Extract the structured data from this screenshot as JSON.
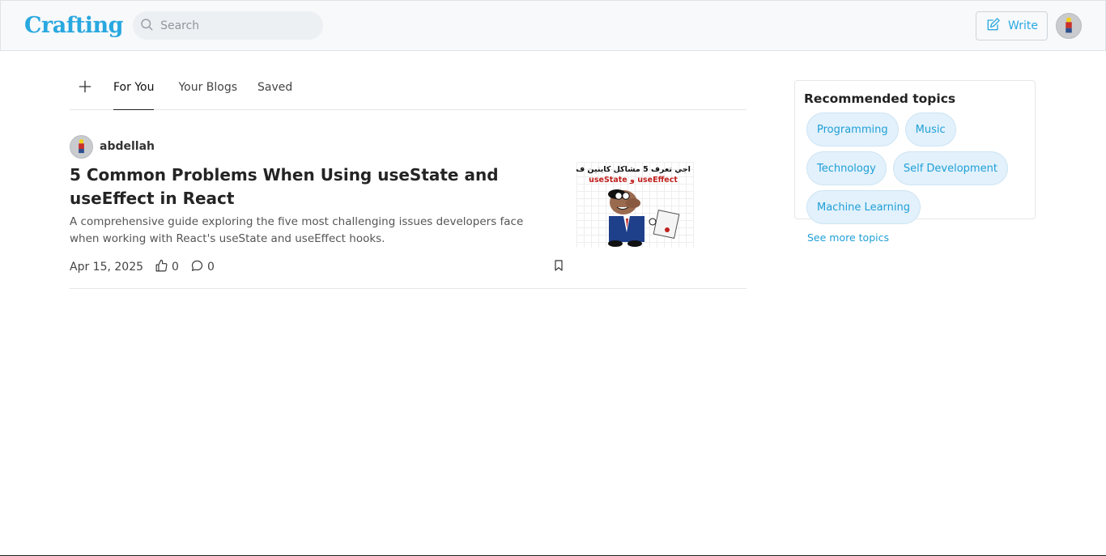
{
  "header": {
    "logo": "Crafting",
    "search_placeholder": "Search",
    "write_label": "Write",
    "brand_color": "#29a8e0"
  },
  "tabs": [
    {
      "label": "For You",
      "active": true
    },
    {
      "label": "Your Blogs",
      "active": false
    },
    {
      "label": "Saved",
      "active": false
    }
  ],
  "article": {
    "author": "abdellah",
    "title": "5 Common Problems When Using useState and useEffect in React",
    "description": "A comprehensive guide exploring the five most challenging issues developers face when working with React's useState and useEffect hooks.",
    "date": "Apr 15, 2025",
    "likes": "0",
    "comments": "0",
    "thumbnail_text_line1": "اجي تعرف 5 مشاكل كاينين ف",
    "thumbnail_text_line2": "useState و useEffect"
  },
  "sidebar": {
    "title": "Recommended topics",
    "topics": [
      "Programming",
      "Music",
      "Technology",
      "Self Development",
      "Machine Learning"
    ],
    "see_more": "See more topics"
  },
  "icons": {
    "search": "search-icon",
    "write": "pencil-square-icon",
    "add": "plus-icon",
    "like": "thumbs-up-icon",
    "comment": "comment-bubble-icon",
    "bookmark": "bookmark-icon"
  }
}
